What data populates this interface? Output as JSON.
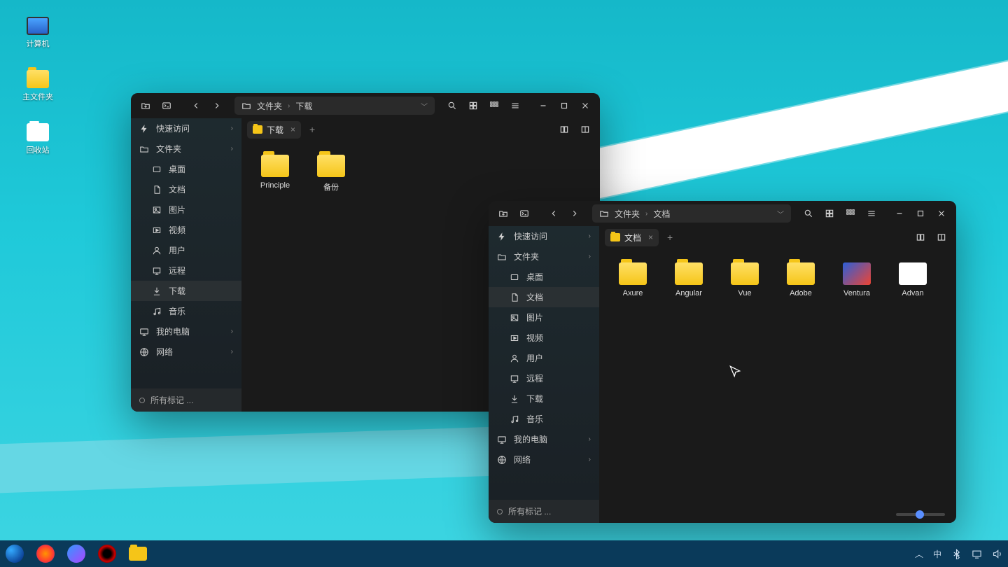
{
  "desktop": {
    "icons": [
      {
        "label": "计算机",
        "type": "computer"
      },
      {
        "label": "主文件夹",
        "type": "folder"
      },
      {
        "label": "回收站",
        "type": "trash"
      }
    ]
  },
  "window1": {
    "breadcrumb": {
      "root": "文件夹",
      "current": "下载"
    },
    "tab_label": "下载",
    "sidebar": {
      "quick": "快速访问",
      "folders": "文件夹",
      "subs": [
        "桌面",
        "文档",
        "图片",
        "视频",
        "用户",
        "远程",
        "下载",
        "音乐"
      ],
      "computer": "我的电脑",
      "network": "网络",
      "tags": "所有标记 ..."
    },
    "files": [
      "Principle",
      "备份"
    ],
    "active_sub": "下载"
  },
  "window2": {
    "breadcrumb": {
      "root": "文件夹",
      "current": "文档"
    },
    "tab_label": "文档",
    "sidebar": {
      "quick": "快速访问",
      "folders": "文件夹",
      "subs": [
        "桌面",
        "文档",
        "图片",
        "视频",
        "用户",
        "远程",
        "下载",
        "音乐"
      ],
      "computer": "我的电脑",
      "network": "网络",
      "tags": "所有标记 ..."
    },
    "files": [
      {
        "name": "Axure",
        "type": "folder"
      },
      {
        "name": "Angular",
        "type": "folder"
      },
      {
        "name": "Vue",
        "type": "folder"
      },
      {
        "name": "Adobe",
        "type": "folder"
      },
      {
        "name": "Ventura",
        "type": "img"
      },
      {
        "name": "Advan",
        "type": "img2"
      }
    ],
    "active_sub": "文档"
  },
  "tray": {
    "ime": "中"
  }
}
